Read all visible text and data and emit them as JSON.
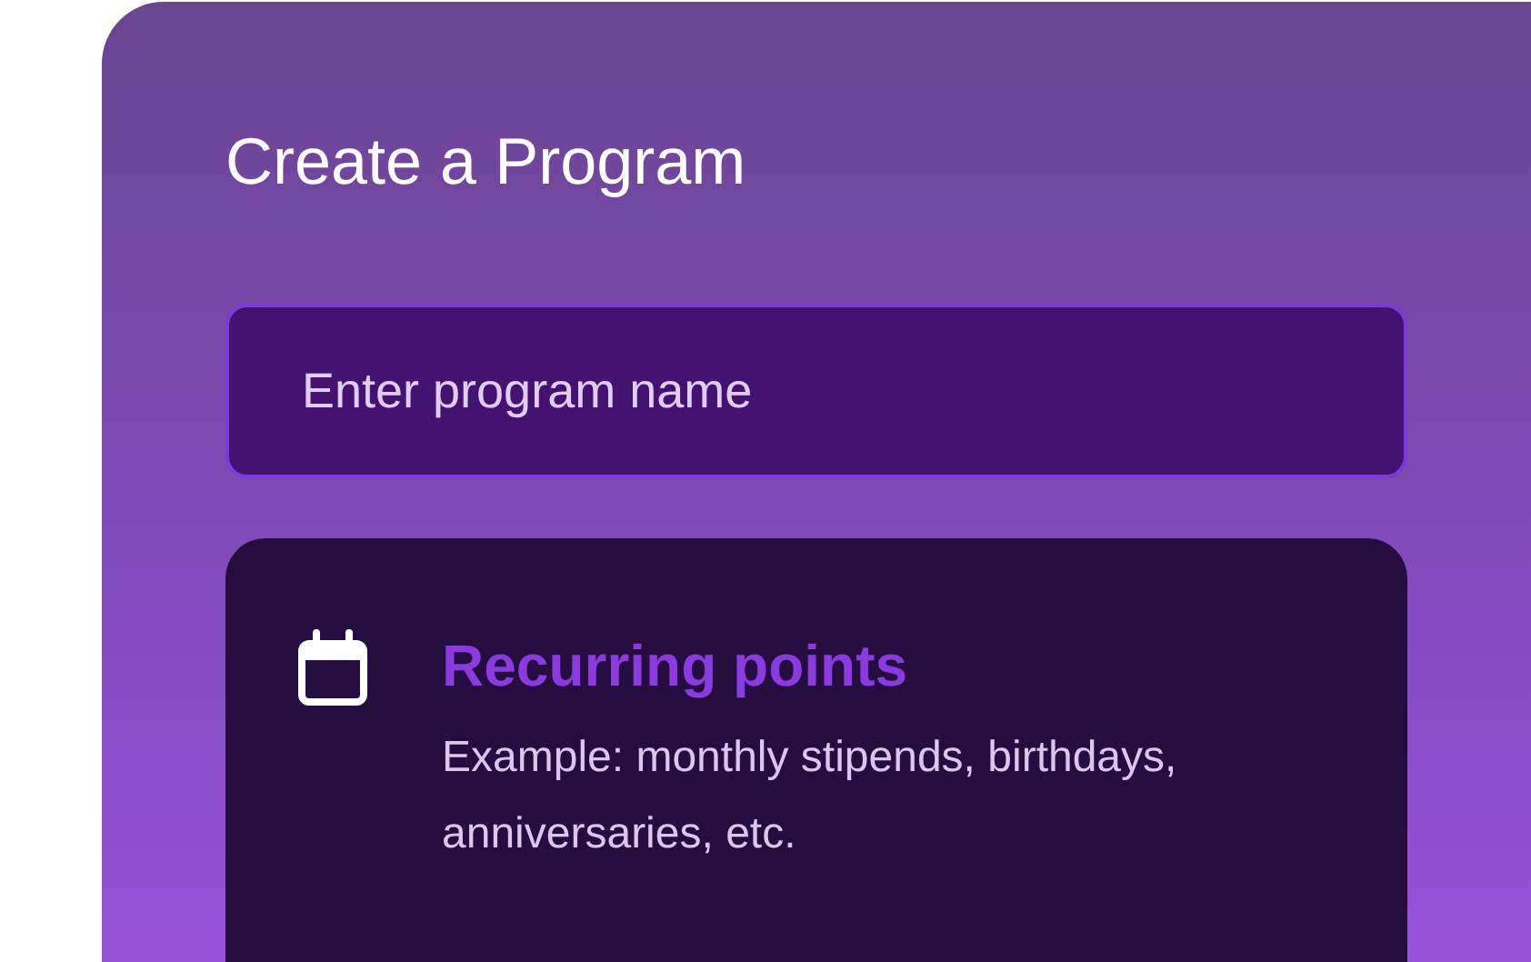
{
  "title": "Create a Program",
  "name_field": {
    "placeholder": "Enter program name"
  },
  "options": [
    {
      "title": "Recurring points",
      "description": "Example: monthly stipends, birthdays, anniversaries, etc."
    }
  ]
}
